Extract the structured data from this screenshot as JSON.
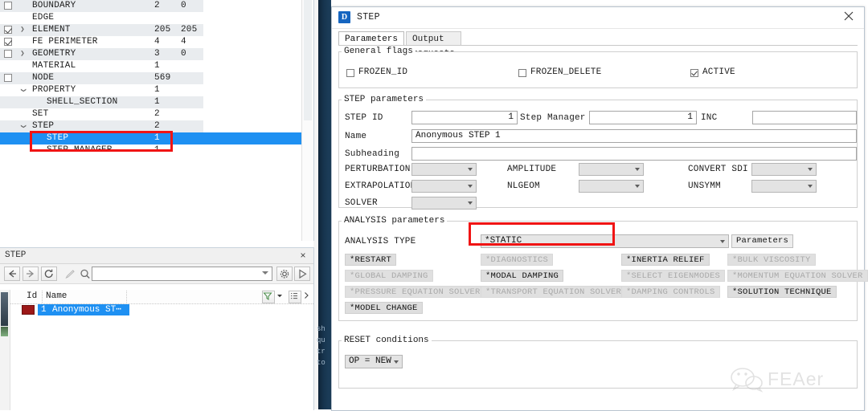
{
  "tree": {
    "columns": [
      "name",
      "count_a",
      "count_b"
    ],
    "rows": [
      {
        "label": "BOUNDARY",
        "a": "2",
        "b": "0",
        "checkbox": "unchecked",
        "arrow": "",
        "indent": 0,
        "alt": true,
        "selected": false
      },
      {
        "label": "EDGE",
        "a": "",
        "b": "",
        "checkbox": "none",
        "arrow": "",
        "indent": 0,
        "alt": false,
        "selected": false
      },
      {
        "label": "ELEMENT",
        "a": "205",
        "b": "205",
        "checkbox": "checked",
        "arrow": "collapsed",
        "indent": 0,
        "alt": true,
        "selected": false
      },
      {
        "label": "FE PERIMETER",
        "a": "4",
        "b": "4",
        "checkbox": "checked",
        "arrow": "",
        "indent": 0,
        "alt": false,
        "selected": false
      },
      {
        "label": "GEOMETRY",
        "a": "3",
        "b": "0",
        "checkbox": "unchecked",
        "arrow": "collapsed",
        "indent": 0,
        "alt": true,
        "selected": false
      },
      {
        "label": "MATERIAL",
        "a": "1",
        "b": "",
        "checkbox": "none",
        "arrow": "",
        "indent": 0,
        "alt": false,
        "selected": false
      },
      {
        "label": "NODE",
        "a": "569",
        "b": "",
        "checkbox": "unchecked",
        "arrow": "",
        "indent": 0,
        "alt": true,
        "selected": false
      },
      {
        "label": "PROPERTY",
        "a": "1",
        "b": "",
        "checkbox": "none",
        "arrow": "expanded",
        "indent": 0,
        "alt": false,
        "selected": false
      },
      {
        "label": "SHELL_SECTION",
        "a": "1",
        "b": "",
        "checkbox": "none",
        "arrow": "",
        "indent": 1,
        "alt": true,
        "selected": false
      },
      {
        "label": "SET",
        "a": "2",
        "b": "",
        "checkbox": "none",
        "arrow": "",
        "indent": 0,
        "alt": false,
        "selected": false
      },
      {
        "label": "STEP",
        "a": "2",
        "b": "",
        "checkbox": "none",
        "arrow": "expanded",
        "indent": 0,
        "alt": true,
        "selected": false
      },
      {
        "label": "STEP",
        "a": "1",
        "b": "",
        "checkbox": "none",
        "arrow": "",
        "indent": 1,
        "alt": false,
        "selected": true
      },
      {
        "label": "STEP MANAGER",
        "a": "1",
        "b": "",
        "checkbox": "none",
        "arrow": "",
        "indent": 1,
        "alt": false,
        "selected": false
      }
    ]
  },
  "clipped_text": [
    "sh",
    "qu",
    "tr",
    "to"
  ],
  "dock": {
    "title": "STEP",
    "close_label": "×",
    "toolbar": {
      "back_icon": "back-arrow-icon",
      "forward_icon": "forward-arrow-icon",
      "refresh_icon": "refresh-icon",
      "pen_icon": "pen-icon",
      "search_icon": "search-icon",
      "gear_icon": "gear-icon",
      "cursor_icon": "cursor-arrow-icon",
      "search_value": "",
      "search_placeholder": ""
    },
    "grid": {
      "headers": [
        "Id",
        "Name"
      ],
      "rows": [
        {
          "id": "1",
          "name": "Anonymous ST⋯",
          "color": "#9c1818"
        }
      ],
      "filter_icon": "filter-funnel-icon",
      "columns_icon": "column-list-icon",
      "expand_icon": "chevron-right-icon"
    }
  },
  "dialog": {
    "title": "STEP",
    "app_icon": "app-icon",
    "close_icon": "close-icon",
    "tabs": [
      {
        "label": "Parameters",
        "active": true
      },
      {
        "label": "Output requests",
        "active": false
      }
    ],
    "general_flags": {
      "group_label": "General flags",
      "checkboxes": [
        {
          "label": "FROZEN_ID",
          "checked": false
        },
        {
          "label": "FROZEN_DELETE",
          "checked": false
        },
        {
          "label": "ACTIVE",
          "checked": true
        }
      ]
    },
    "step_parameters": {
      "group_label": "STEP parameters",
      "step_id_label": "STEP ID",
      "step_id_value": "1",
      "step_manager_label": "Step Manager",
      "step_manager_value": "1",
      "inc_label": "INC",
      "inc_value": "",
      "name_label": "Name",
      "name_value": "Anonymous STEP 1",
      "subheading_label": "Subheading",
      "subheading_value": "",
      "combos": [
        {
          "label": "PERTURBATION",
          "value": ""
        },
        {
          "label": "AMPLITUDE",
          "value": ""
        },
        {
          "label": "CONVERT SDI",
          "value": ""
        },
        {
          "label": "EXTRAPOLATION",
          "value": ""
        },
        {
          "label": "NLGEOM",
          "value": ""
        },
        {
          "label": "UNSYMM",
          "value": ""
        },
        {
          "label": "SOLVER",
          "value": ""
        }
      ]
    },
    "analysis_parameters": {
      "group_label": "ANALYSIS parameters",
      "analysis_type_label": "ANALYSIS TYPE",
      "analysis_type_value": "*STATIC",
      "parameters_button": "Parameters",
      "keyword_buttons": [
        {
          "label": "*RESTART",
          "enabled": true,
          "row": 0,
          "col": 0
        },
        {
          "label": "*DIAGNOSTICS",
          "enabled": false,
          "row": 0,
          "col": 1
        },
        {
          "label": "*INERTIA RELIEF",
          "enabled": true,
          "row": 0,
          "col": 2
        },
        {
          "label": "*BULK VISCOSITY",
          "enabled": false,
          "row": 0,
          "col": 3
        },
        {
          "label": "*GLOBAL DAMPING",
          "enabled": false,
          "row": 1,
          "col": 0
        },
        {
          "label": "*MODAL DAMPING",
          "enabled": true,
          "row": 1,
          "col": 1
        },
        {
          "label": "*SELECT EIGENMODES",
          "enabled": false,
          "row": 1,
          "col": 2
        },
        {
          "label": "*MOMENTUM EQUATION SOLVER",
          "enabled": false,
          "row": 1,
          "col": 3
        },
        {
          "label": "*PRESSURE EQUATION SOLVER",
          "enabled": false,
          "row": 2,
          "col": 0
        },
        {
          "label": "*TRANSPORT EQUATION SOLVER",
          "enabled": false,
          "row": 2,
          "col": 1
        },
        {
          "label": "*DAMPING CONTROLS",
          "enabled": false,
          "row": 2,
          "col": 2
        },
        {
          "label": "*SOLUTION TECHNIQUE",
          "enabled": true,
          "row": 2,
          "col": 3
        },
        {
          "label": "*MODEL CHANGE",
          "enabled": true,
          "row": 3,
          "col": 0
        }
      ]
    },
    "reset_conditions": {
      "group_label": "RESET conditions",
      "op_value": "OP = NEW"
    }
  },
  "watermark": {
    "text": "FEAer",
    "icon": "wechat-icon"
  },
  "annotation": {
    "color": "#f01414",
    "boxes": 2
  }
}
